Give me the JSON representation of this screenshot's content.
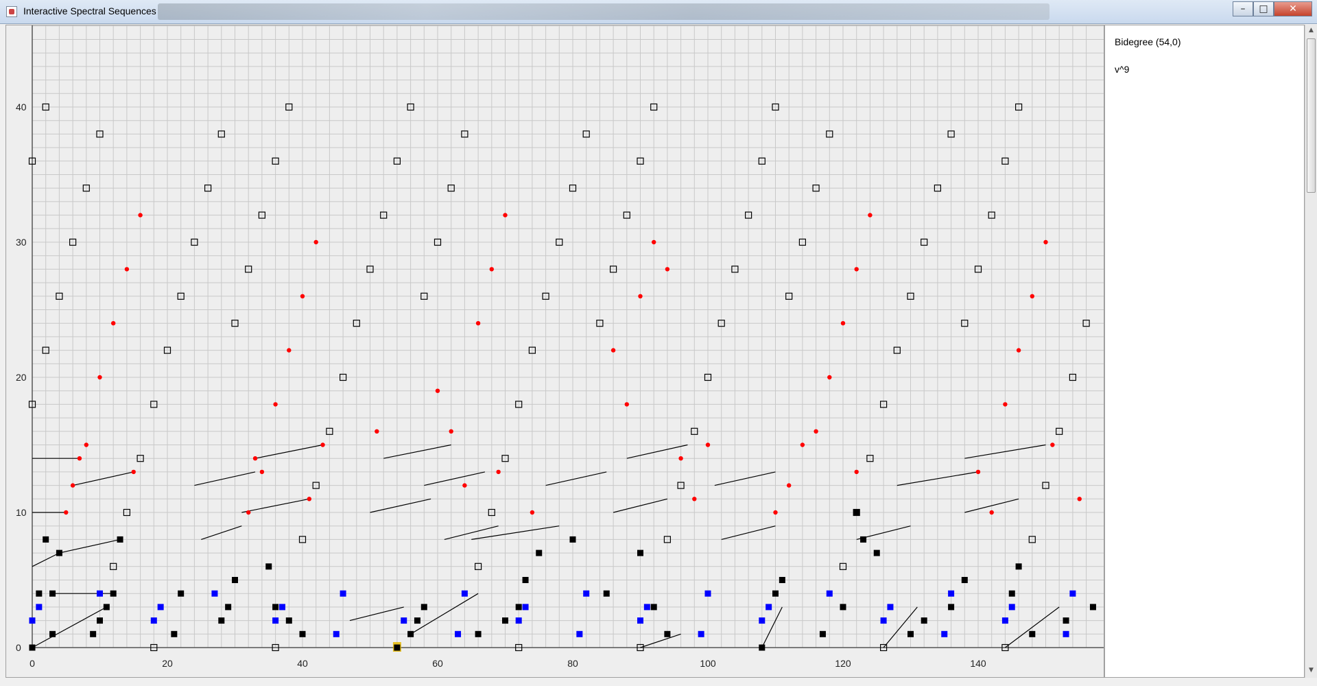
{
  "window": {
    "title": "Interactive Spectral Sequences",
    "minimize": "–",
    "maximize": "□",
    "close": "✕"
  },
  "info": {
    "bidegree": "Bidegree (54,0)",
    "generator": "v^9"
  },
  "colors": {
    "black": "#000000",
    "red": "#ff0000",
    "blue": "#0000ff",
    "selected": "#e6b800",
    "grid": "#c8c8c8",
    "grid_major": "#9a9a9a"
  },
  "chart_data": {
    "type": "scatter",
    "xlim": [
      0,
      156
    ],
    "ylim": [
      0,
      45
    ],
    "x_ticks": [
      "0",
      "20",
      "40",
      "60",
      "80",
      "100",
      "120",
      "140"
    ],
    "y_ticks": [
      "0",
      "10",
      "20",
      "30",
      "40"
    ],
    "grid": true,
    "selected": [
      54,
      0
    ],
    "series": [
      {
        "marker": "filled-black-square",
        "points": [
          [
            0,
            0
          ],
          [
            3,
            1
          ],
          [
            9,
            1
          ],
          [
            10,
            2
          ],
          [
            11,
            3
          ],
          [
            12,
            4
          ],
          [
            3,
            4
          ],
          [
            1,
            4
          ],
          [
            4,
            7
          ],
          [
            13,
            8
          ],
          [
            2,
            8
          ],
          [
            21,
            1
          ],
          [
            22,
            4
          ],
          [
            28,
            2
          ],
          [
            29,
            3
          ],
          [
            30,
            5
          ],
          [
            35,
            6
          ],
          [
            40,
            1
          ],
          [
            38,
            2
          ],
          [
            36,
            3
          ],
          [
            56,
            1
          ],
          [
            57,
            2
          ],
          [
            58,
            3
          ],
          [
            66,
            1
          ],
          [
            70,
            2
          ],
          [
            72,
            3
          ],
          [
            73,
            5
          ],
          [
            75,
            7
          ],
          [
            80,
            8
          ],
          [
            85,
            4
          ],
          [
            94,
            1
          ],
          [
            92,
            3
          ],
          [
            90,
            7
          ],
          [
            108,
            0
          ],
          [
            110,
            4
          ],
          [
            111,
            5
          ],
          [
            117,
            1
          ],
          [
            120,
            3
          ],
          [
            122,
            10
          ],
          [
            125,
            7
          ],
          [
            123,
            8
          ],
          [
            130,
            1
          ],
          [
            132,
            2
          ],
          [
            136,
            3
          ],
          [
            138,
            5
          ],
          [
            146,
            6
          ],
          [
            145,
            4
          ],
          [
            148,
            1
          ],
          [
            153,
            2
          ],
          [
            157,
            3
          ]
        ]
      },
      {
        "marker": "open-square",
        "points": [
          [
            0,
            18
          ],
          [
            0,
            36
          ],
          [
            2,
            22
          ],
          [
            2,
            40
          ],
          [
            4,
            26
          ],
          [
            6,
            30
          ],
          [
            8,
            34
          ],
          [
            10,
            38
          ],
          [
            12,
            6
          ],
          [
            14,
            10
          ],
          [
            16,
            14
          ],
          [
            18,
            18
          ],
          [
            20,
            22
          ],
          [
            22,
            26
          ],
          [
            24,
            30
          ],
          [
            26,
            34
          ],
          [
            28,
            38
          ],
          [
            30,
            24
          ],
          [
            32,
            28
          ],
          [
            34,
            32
          ],
          [
            36,
            36
          ],
          [
            38,
            40
          ],
          [
            40,
            8
          ],
          [
            42,
            12
          ],
          [
            44,
            16
          ],
          [
            46,
            20
          ],
          [
            48,
            24
          ],
          [
            50,
            28
          ],
          [
            52,
            32
          ],
          [
            54,
            36
          ],
          [
            56,
            40
          ],
          [
            58,
            26
          ],
          [
            60,
            30
          ],
          [
            62,
            34
          ],
          [
            64,
            38
          ],
          [
            66,
            6
          ],
          [
            68,
            10
          ],
          [
            70,
            14
          ],
          [
            72,
            18
          ],
          [
            74,
            22
          ],
          [
            76,
            26
          ],
          [
            78,
            30
          ],
          [
            80,
            34
          ],
          [
            82,
            38
          ],
          [
            84,
            24
          ],
          [
            86,
            28
          ],
          [
            88,
            32
          ],
          [
            90,
            36
          ],
          [
            92,
            40
          ],
          [
            94,
            8
          ],
          [
            96,
            12
          ],
          [
            98,
            16
          ],
          [
            100,
            20
          ],
          [
            102,
            24
          ],
          [
            104,
            28
          ],
          [
            106,
            32
          ],
          [
            108,
            36
          ],
          [
            110,
            40
          ],
          [
            112,
            26
          ],
          [
            114,
            30
          ],
          [
            116,
            34
          ],
          [
            118,
            38
          ],
          [
            120,
            6
          ],
          [
            122,
            10
          ],
          [
            124,
            14
          ],
          [
            126,
            18
          ],
          [
            128,
            22
          ],
          [
            130,
            26
          ],
          [
            132,
            30
          ],
          [
            134,
            34
          ],
          [
            136,
            38
          ],
          [
            138,
            24
          ],
          [
            140,
            28
          ],
          [
            142,
            32
          ],
          [
            144,
            36
          ],
          [
            146,
            40
          ],
          [
            148,
            8
          ],
          [
            150,
            12
          ],
          [
            152,
            16
          ],
          [
            154,
            20
          ],
          [
            156,
            24
          ],
          [
            18,
            0
          ],
          [
            36,
            0
          ],
          [
            72,
            0
          ],
          [
            90,
            0
          ],
          [
            126,
            0
          ],
          [
            144,
            0
          ]
        ]
      },
      {
        "marker": "red-dot",
        "points": [
          [
            7,
            14
          ],
          [
            8,
            15
          ],
          [
            10,
            20
          ],
          [
            12,
            24
          ],
          [
            14,
            28
          ],
          [
            16,
            32
          ],
          [
            6,
            12
          ],
          [
            5,
            10
          ],
          [
            15,
            13
          ],
          [
            33,
            14
          ],
          [
            36,
            18
          ],
          [
            32,
            10
          ],
          [
            41,
            11
          ],
          [
            38,
            22
          ],
          [
            40,
            26
          ],
          [
            42,
            30
          ],
          [
            43,
            15
          ],
          [
            34,
            13
          ],
          [
            51,
            16
          ],
          [
            60,
            19
          ],
          [
            62,
            16
          ],
          [
            64,
            12
          ],
          [
            66,
            24
          ],
          [
            68,
            28
          ],
          [
            70,
            32
          ],
          [
            69,
            13
          ],
          [
            74,
            10
          ],
          [
            86,
            22
          ],
          [
            88,
            18
          ],
          [
            90,
            26
          ],
          [
            92,
            30
          ],
          [
            94,
            28
          ],
          [
            96,
            14
          ],
          [
            98,
            11
          ],
          [
            100,
            15
          ],
          [
            116,
            16
          ],
          [
            118,
            20
          ],
          [
            120,
            24
          ],
          [
            122,
            28
          ],
          [
            124,
            32
          ],
          [
            114,
            15
          ],
          [
            112,
            12
          ],
          [
            110,
            10
          ],
          [
            122,
            13
          ],
          [
            140,
            13
          ],
          [
            142,
            10
          ],
          [
            144,
            18
          ],
          [
            146,
            22
          ],
          [
            148,
            26
          ],
          [
            150,
            30
          ],
          [
            151,
            15
          ],
          [
            155,
            11
          ]
        ]
      },
      {
        "marker": "blue-square",
        "points": [
          [
            0,
            2
          ],
          [
            1,
            3
          ],
          [
            10,
            4
          ],
          [
            18,
            2
          ],
          [
            19,
            3
          ],
          [
            27,
            4
          ],
          [
            36,
            2
          ],
          [
            37,
            3
          ],
          [
            46,
            4
          ],
          [
            45,
            1
          ],
          [
            55,
            2
          ],
          [
            63,
            1
          ],
          [
            64,
            4
          ],
          [
            72,
            2
          ],
          [
            73,
            3
          ],
          [
            81,
            1
          ],
          [
            82,
            4
          ],
          [
            90,
            2
          ],
          [
            91,
            3
          ],
          [
            100,
            4
          ],
          [
            99,
            1
          ],
          [
            108,
            2
          ],
          [
            109,
            3
          ],
          [
            118,
            4
          ],
          [
            126,
            2
          ],
          [
            127,
            3
          ],
          [
            135,
            1
          ],
          [
            136,
            4
          ],
          [
            144,
            2
          ],
          [
            145,
            3
          ],
          [
            154,
            4
          ],
          [
            153,
            1
          ]
        ]
      }
    ]
  }
}
